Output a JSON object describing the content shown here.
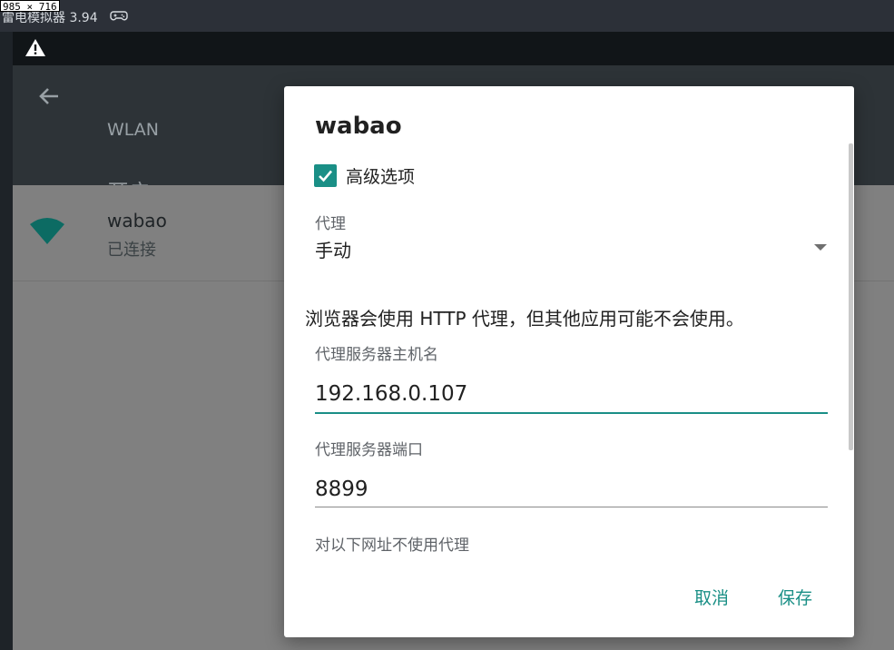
{
  "window": {
    "dimension_tag": "985 × 716",
    "title": "雷电模拟器 3.94",
    "gamepad_icon": "gamepad-icon"
  },
  "status_bar": {
    "icon": "warning-icon"
  },
  "app_bar": {
    "back_icon": "arrow-back-icon",
    "title": "WLAN",
    "toggle_text": "开启"
  },
  "network_list": [
    {
      "ssid": "wabao",
      "status": "已连接",
      "icon": "wifi-full-icon"
    }
  ],
  "dialog": {
    "title": "wabao",
    "advanced_checked": true,
    "advanced_label": "高级选项",
    "proxy_label": "代理",
    "proxy_value": "手动",
    "note": "浏览器会使用 HTTP 代理，但其他应用可能不会使用。",
    "host_label": "代理服务器主机名",
    "host_value": "192.168.0.107",
    "port_label": "代理服务器端口",
    "port_value": "8899",
    "bypass_label": "对以下网址不使用代理",
    "cancel_label": "取消",
    "save_label": "保存"
  },
  "colors": {
    "accent": "#1a8f86",
    "status_bar": "#111518",
    "app_bar": "#2d3337",
    "scrim": "#808080"
  }
}
